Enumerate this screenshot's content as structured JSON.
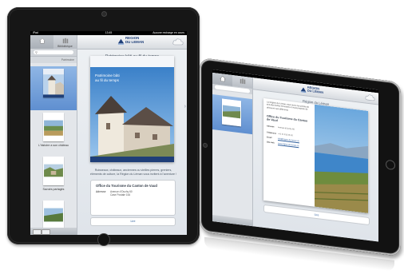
{
  "left_ipad": {
    "status_bar": {
      "carrier": "iPad",
      "time": "13:45",
      "status": "Aucune recharge en cours"
    },
    "tabs": [
      {
        "label": "",
        "icon": "home-icon",
        "active": true
      },
      {
        "label": "Bibliothèque",
        "icon": "library-icon",
        "active": false
      }
    ],
    "section_label": "Patrimoine",
    "items": [
      {
        "caption": "",
        "thumb_title": "",
        "selected": true
      },
      {
        "caption": "L'histoire a son château",
        "thumb_title": ""
      },
      {
        "caption": "Savoirs partagés",
        "thumb_title": ""
      },
      {
        "caption": "Les ailes de Mons",
        "thumb_title": ""
      }
    ],
    "header": {
      "logo_line1": "REGION",
      "logo_line2": "DU LEMAN",
      "logo_sub": "",
      "right_icon": "cloud-share-icon"
    },
    "main": {
      "page_title": "Patrimoine bâti au fil du temps",
      "cover_title_line1": "Patrimoine bâti",
      "cover_title_line2": "au fil du temps",
      "cover_url": "",
      "description": "Ruisseaux, châteaux, anciennes ou vieilles pierres, greniers, éléments de culture, la Région du Léman vous invitent à l'aventure !",
      "office_name": "Office du Tourisme du Canton de Vaud",
      "address_label": "Adresse",
      "address_line1": "Avenue d'Ouchy 60",
      "address_line2": "Case Postale 164",
      "link_label": "Lire"
    }
  },
  "right_ipad": {
    "header": {
      "logo_line1": "REGION",
      "logo_line2": "DU LEMAN",
      "right_icon": "cloud-share-icon"
    },
    "main": {
      "page_title": "Région du Léman",
      "intro": "La Région du Léman vous ouvre les portes de ses plus belles richesses et vous propose de découvrir ses différents",
      "office_name": "Office du Tourisme du Canton de Vaud",
      "address_label": "Adresse",
      "address_value": "Avenue d'Ouchy 60",
      "phone_label": "Téléphone",
      "phone_value": "+41 21 613 26 26",
      "email_label": "Email",
      "email_value": "info@region-du-leman.ch",
      "web_label": "Site web",
      "web_value": "www.region-du-leman.ch",
      "link_label": "Lire"
    }
  },
  "colors": {
    "accent": "#1f3f78",
    "selection": "#5f8fd0",
    "link": "#2d5d9b",
    "bezel": "#161616"
  }
}
